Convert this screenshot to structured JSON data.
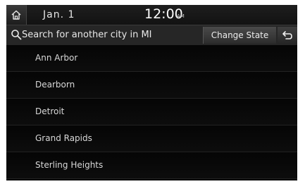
{
  "status_bar": {
    "date": "Jan.  1",
    "time": "12:00",
    "ampm": "AM"
  },
  "toolbar": {
    "search_label": "Search for another city in MI",
    "change_state_label": "Change State"
  },
  "cities": [
    {
      "label": "Ann Arbor"
    },
    {
      "label": "Dearborn"
    },
    {
      "label": "Detroit"
    },
    {
      "label": "Grand Rapids"
    },
    {
      "label": "Sterling Heights"
    }
  ],
  "icons": {
    "home": "home-icon",
    "search": "search-icon",
    "back": "back-icon"
  }
}
